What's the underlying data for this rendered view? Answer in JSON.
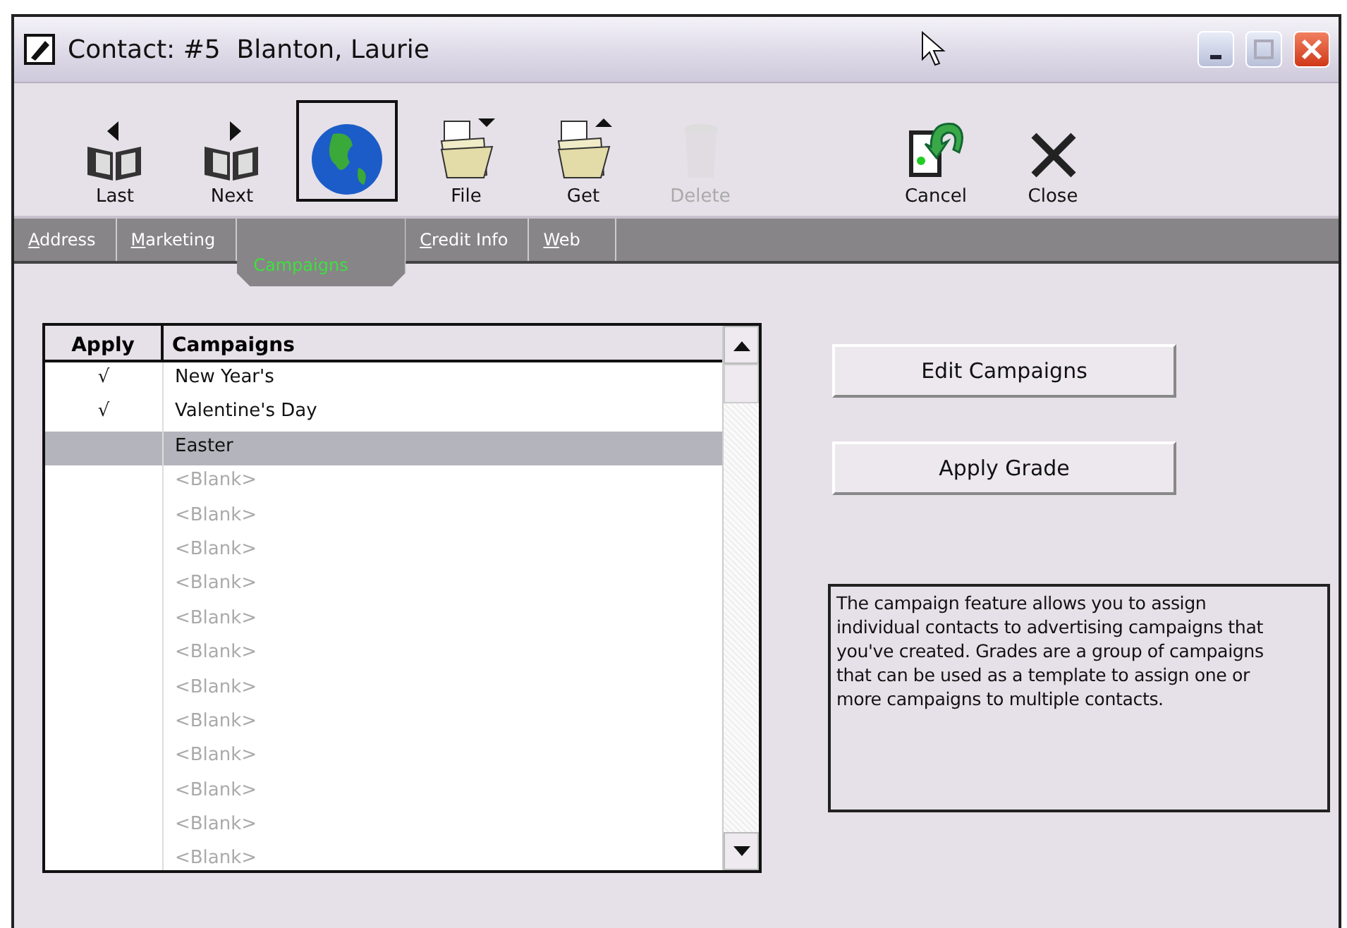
{
  "window": {
    "title": "Contact: #5  Blanton, Laurie"
  },
  "toolbar": [
    {
      "kind": "prev",
      "label": "Last",
      "disabled": false,
      "selected": false
    },
    {
      "kind": "next",
      "label": "Next",
      "disabled": false,
      "selected": false
    },
    {
      "kind": "globe",
      "disabled": false,
      "selected": true
    },
    {
      "kind": "file",
      "label": "File",
      "disabled": false,
      "selected": false
    },
    {
      "kind": "get",
      "label": "Get",
      "disabled": false,
      "selected": false
    },
    {
      "kind": "delete",
      "label": "Delete",
      "disabled": true,
      "selected": false
    },
    {
      "kind": "cancel",
      "label": "Cancel",
      "disabled": false,
      "selected": false
    },
    {
      "kind": "close",
      "label": "Close",
      "disabled": false,
      "selected": false
    }
  ],
  "tabs": [
    {
      "label": "Address",
      "selected": false
    },
    {
      "label": "Marketing",
      "selected": false
    },
    {
      "label": "Campaigns",
      "selected": true
    },
    {
      "label": "Credit Info",
      "selected": false
    },
    {
      "label": "Web",
      "selected": false
    }
  ],
  "table": {
    "columns": [
      "Apply",
      "Campaigns"
    ],
    "rows": [
      {
        "apply": "√",
        "name": "New Year's",
        "blank": false,
        "selected": false
      },
      {
        "apply": "√",
        "name": "Valentine's Day",
        "blank": false,
        "selected": false
      },
      {
        "name": "Easter",
        "blank": false,
        "selected": true
      },
      {
        "name": "<Blank>",
        "blank": true,
        "selected": false
      },
      {
        "name": "<Blank>",
        "blank": true,
        "selected": false
      },
      {
        "name": "<Blank>",
        "blank": true,
        "selected": false
      },
      {
        "name": "<Blank>",
        "blank": true,
        "selected": false
      },
      {
        "name": "<Blank>",
        "blank": true,
        "selected": false
      },
      {
        "name": "<Blank>",
        "blank": true,
        "selected": false
      },
      {
        "name": "<Blank>",
        "blank": true,
        "selected": false
      },
      {
        "name": "<Blank>",
        "blank": true,
        "selected": false
      },
      {
        "name": "<Blank>",
        "blank": true,
        "selected": false
      },
      {
        "name": "<Blank>",
        "blank": true,
        "selected": false
      },
      {
        "name": "<Blank>",
        "blank": true,
        "selected": false
      },
      {
        "name": "<Blank>",
        "blank": true,
        "selected": false
      }
    ]
  },
  "buttons": [
    "Edit Campaigns",
    "Apply Grade"
  ],
  "help_text": "The campaign feature allows you to assign individual contacts to advertising campaigns that you've created. Grades are a group of campaigns that can be used as a template to assign one or more campaigns to multiple contacts."
}
